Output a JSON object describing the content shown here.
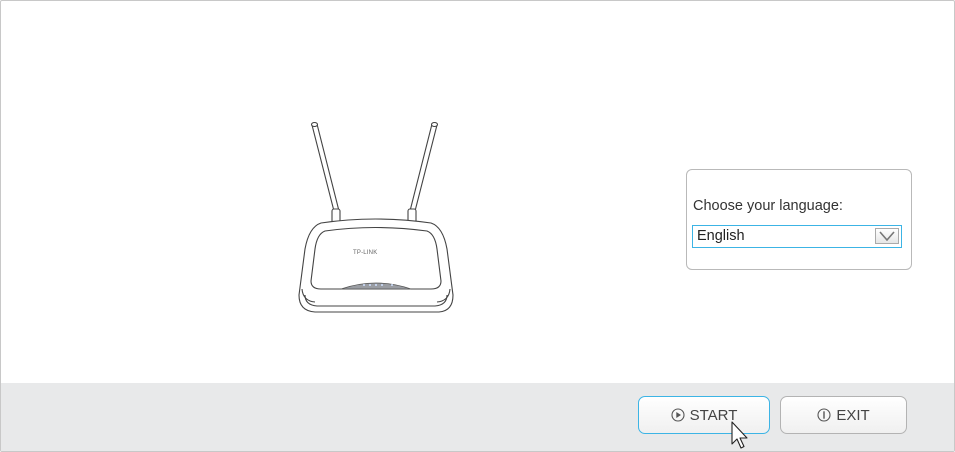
{
  "device": {
    "brand_label": "TP-LINK",
    "image_icon": "router-icon"
  },
  "language": {
    "label": "Choose your language:",
    "selected": "English"
  },
  "footer": {
    "start_label": "START",
    "exit_label": "EXIT",
    "start_icon": "play-circle-icon",
    "exit_icon": "info-circle-icon"
  },
  "colors": {
    "accent": "#3cb4e5",
    "footer_bg": "#e8e9ea",
    "border": "#b9b9b9"
  }
}
